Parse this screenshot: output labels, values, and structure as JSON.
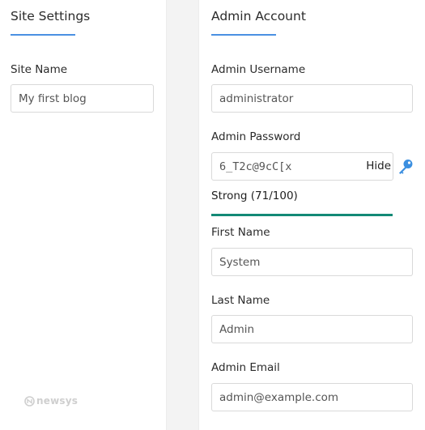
{
  "site_settings": {
    "title": "Site Settings",
    "site_name_label": "Site Name",
    "site_name_value": "My first blog"
  },
  "admin_account": {
    "title": "Admin Account",
    "username_label": "Admin Username",
    "username_value": "administrator",
    "password_label": "Admin Password",
    "password_value": "6_T2c@9cC[x",
    "hide_label": "Hide",
    "strength_text": "Strong (71/100)",
    "strength_score": 71,
    "strength_max": 100,
    "first_name_label": "First Name",
    "first_name_value": "System",
    "last_name_label": "Last Name",
    "last_name_value": "Admin",
    "email_label": "Admin Email",
    "email_value": "admin@example.com"
  },
  "branding": {
    "logo_text": "newsys"
  },
  "colors": {
    "accent": "#4a90e2",
    "strength_strong": "#138a76",
    "key_icon": "#3b8fe0"
  }
}
